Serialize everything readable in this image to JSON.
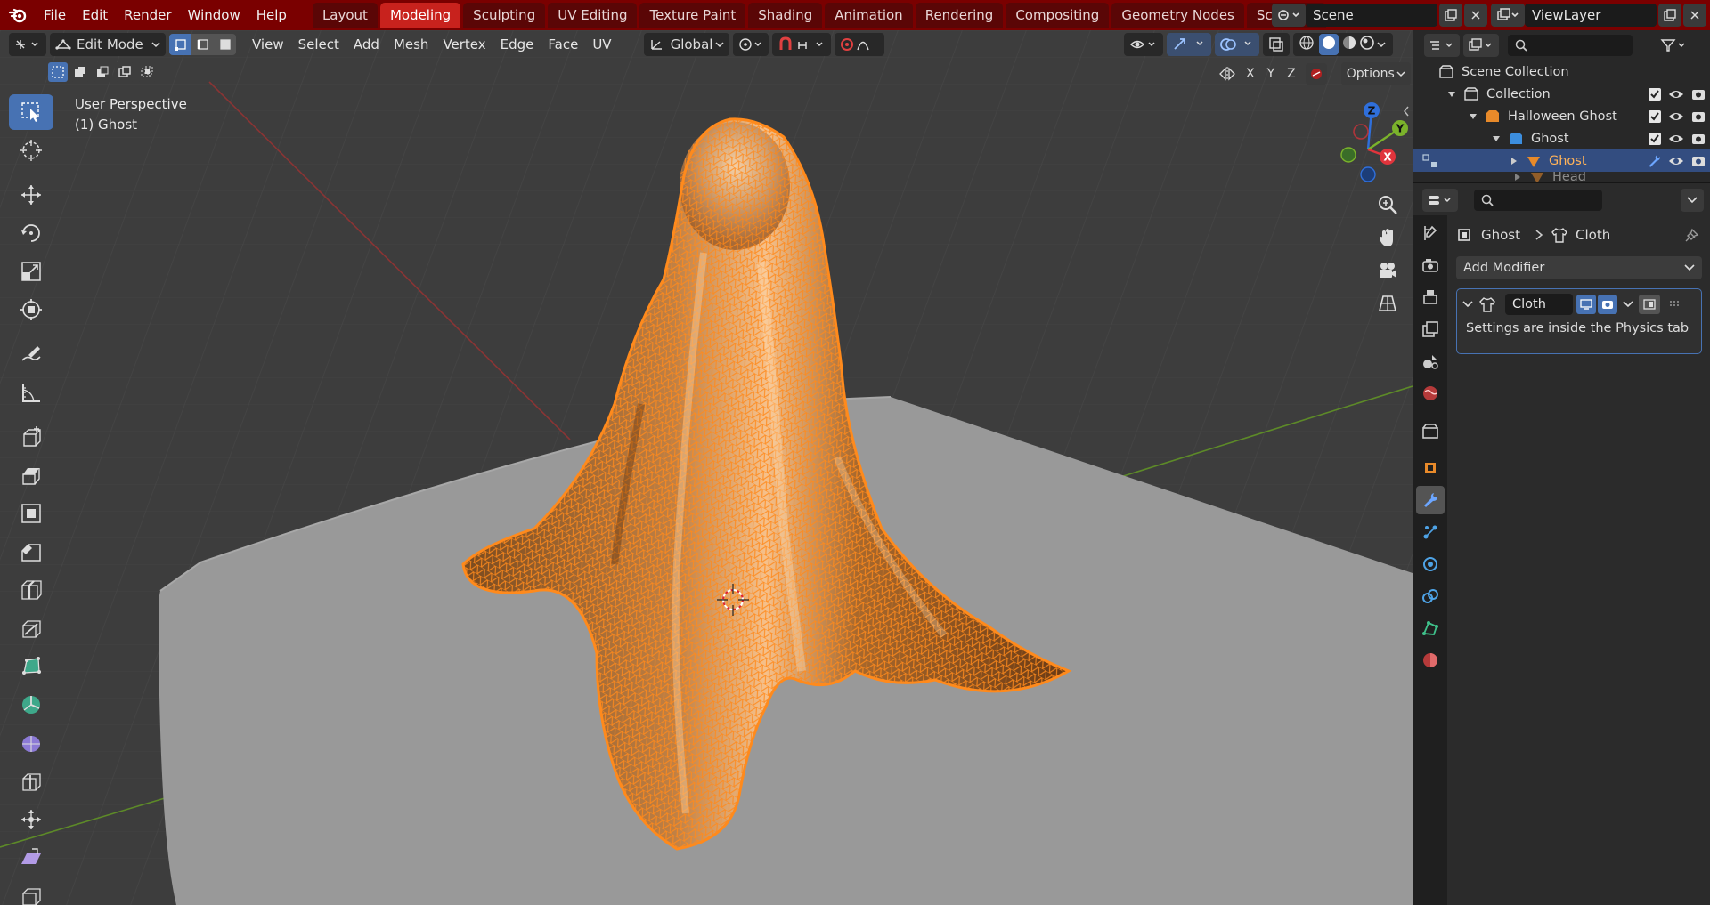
{
  "topbar": {
    "menus": [
      "File",
      "Edit",
      "Render",
      "Window",
      "Help"
    ],
    "workspaces": [
      "Layout",
      "Modeling",
      "Sculpting",
      "UV Editing",
      "Texture Paint",
      "Shading",
      "Animation",
      "Rendering",
      "Compositing",
      "Geometry Nodes",
      "Scripting"
    ],
    "active_workspace": "Modeling",
    "scene_name": "Scene",
    "view_layer": "ViewLayer"
  },
  "viewport_header": {
    "mode": "Edit Mode",
    "menus": [
      "View",
      "Select",
      "Add",
      "Mesh",
      "Vertex",
      "Edge",
      "Face",
      "UV"
    ],
    "transform_orientation": "Global",
    "axes": [
      "X",
      "Y",
      "Z"
    ],
    "options_label": "Options"
  },
  "viewport_overlay": {
    "perspective": "User Perspective",
    "object": "(1) Ghost"
  },
  "gizmo": {
    "x": "X",
    "y": "Y",
    "z": "Z"
  },
  "outliner": {
    "rows": [
      {
        "label": "Scene Collection"
      },
      {
        "label": "Collection"
      },
      {
        "label": "Halloween Ghost"
      },
      {
        "label": "Ghost"
      },
      {
        "label": "Ghost"
      },
      {
        "label": "Head"
      }
    ]
  },
  "properties": {
    "breadcrumb_object": "Ghost",
    "breadcrumb_modifier": "Cloth",
    "add_modifier": "Add Modifier",
    "modifier_name": "Cloth",
    "modifier_note": "Settings are inside the Physics tab"
  },
  "colors": {
    "topbar": "#7a0000",
    "active_tab": "#c8221d",
    "accent": "#4772b3",
    "mesh_wire": "#ff8a1c",
    "viewport_bg": "#3d3d3d",
    "floor": "#9a9a9a"
  }
}
